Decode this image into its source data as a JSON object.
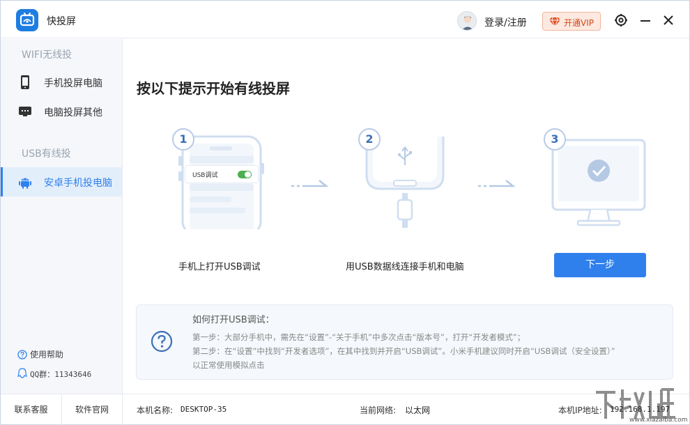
{
  "app": {
    "title": "快投屏"
  },
  "header": {
    "login_label": "登录/注册",
    "vip_label": "开通VIP"
  },
  "sidebar": {
    "sections": [
      {
        "title": "WIFI无线投"
      },
      {
        "title": "USB有线投"
      }
    ],
    "items": [
      {
        "label": "手机投屏电脑",
        "icon": "phone-icon"
      },
      {
        "label": "电脑投屏其他",
        "icon": "monitor-icon"
      },
      {
        "label": "安卓手机投电脑",
        "icon": "android-icon",
        "active": true
      }
    ],
    "help_label": "使用帮助",
    "qq_label": "QQ群：11343646"
  },
  "main": {
    "title": "按以下提示开始有线投屏",
    "steps": [
      {
        "number": "1",
        "caption": "手机上打开USB调试",
        "phone_setting_label": "USB调试"
      },
      {
        "number": "2",
        "caption": "用USB数据线连接手机和电脑"
      },
      {
        "number": "3"
      }
    ],
    "next_label": "下一步"
  },
  "info": {
    "title": "如何打开USB调试：",
    "line1": "第一步：大部分手机中，需先在“设置”-“关于手机”中多次点击“版本号”，打开“开发者模式”；",
    "line2": "第二步：在“设置”中找到“开发者选项”，在其中找到并开启“USB调试”。小米手机建议同时开启“USB调试（安全设置）”",
    "line3": "以正常使用模拟点击"
  },
  "statusbar": {
    "contact_label": "联系客服",
    "website_label": "软件官网",
    "pc_name_label": "本机名称:",
    "pc_name_value": "DESKTOP-35",
    "network_label": "当前网络:",
    "network_value": "以太网",
    "ip_label": "本机IP地址:",
    "ip_value": "192.168.1.197"
  },
  "watermark": {
    "text": "www.xiazaiba.com"
  },
  "colors": {
    "accent": "#2f80ed",
    "vip": "#d2461a",
    "sidebar_active_bg": "#e3eefb"
  }
}
